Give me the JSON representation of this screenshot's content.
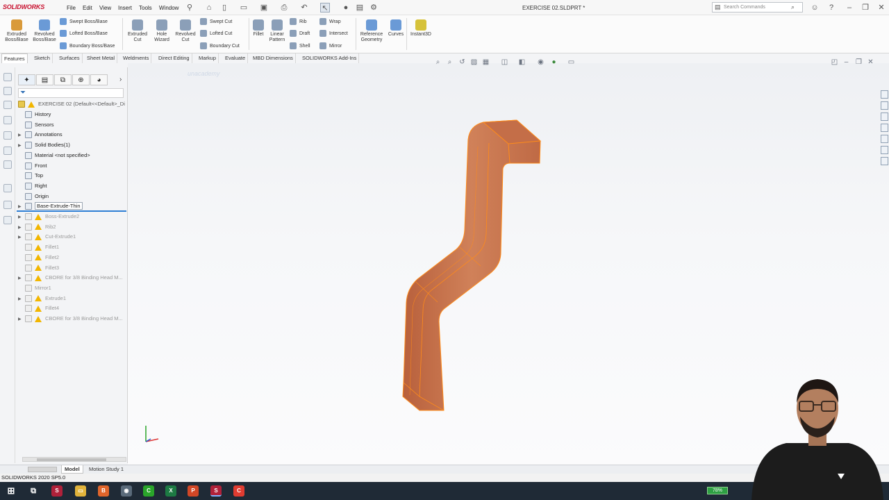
{
  "app": {
    "logo": "SOLIDWORKS",
    "document_title": "EXERCISE 02.SLDPRT *",
    "search_placeholder": "Search Commands",
    "status_text": "SOLIDWORKS 2020 SP5.0",
    "watermark": "unacademy"
  },
  "menu": [
    "File",
    "Edit",
    "View",
    "Insert",
    "Tools",
    "Window"
  ],
  "commands": {
    "extruded_boss": "Extruded\nBoss/Base",
    "revolved_boss": "Revolved\nBoss/Base",
    "swept_boss": "Swept Boss/Base",
    "lofted_boss": "Lofted Boss/Base",
    "boundary_boss": "Boundary Boss/Base",
    "extruded_cut": "Extruded\nCut",
    "hole_wizard": "Hole\nWizard",
    "revolved_cut": "Revolved\nCut",
    "swept_cut": "Swept Cut",
    "lofted_cut": "Lofted Cut",
    "boundary_cut": "Boundary Cut",
    "fillet": "Fillet",
    "linear_pattern": "Linear\nPattern",
    "rib": "Rib",
    "draft": "Draft",
    "shell": "Shell",
    "wrap": "Wrap",
    "intersect": "Intersect",
    "mirror": "Mirror",
    "reference_geometry": "Reference\nGeometry",
    "curves": "Curves",
    "instant3d": "Instant3D"
  },
  "tabs": [
    "Features",
    "Sketch",
    "Surfaces",
    "Sheet Metal",
    "Weldments",
    "Direct Editing",
    "Markup",
    "Evaluate",
    "MBD Dimensions",
    "SOLIDWORKS Add-Ins"
  ],
  "tree": {
    "root": "EXERCISE 02  (Default<<Default>_Di",
    "items": [
      {
        "label": "History",
        "dim": false
      },
      {
        "label": "Sensors",
        "dim": false
      },
      {
        "label": "Annotations",
        "dim": false
      },
      {
        "label": "Solid Bodies(1)",
        "dim": false
      },
      {
        "label": "Material <not specified>",
        "dim": false
      },
      {
        "label": "Front",
        "dim": false
      },
      {
        "label": "Top",
        "dim": false
      },
      {
        "label": "Right",
        "dim": false
      },
      {
        "label": "Origin",
        "dim": false
      },
      {
        "label": "Base-Extrude-Thin",
        "dim": false
      },
      {
        "label": "Boss-Extrude2",
        "dim": true
      },
      {
        "label": "Rib2",
        "dim": true
      },
      {
        "label": "Cut-Extrude1",
        "dim": true
      },
      {
        "label": "Fillet1",
        "dim": true
      },
      {
        "label": "Fillet2",
        "dim": true
      },
      {
        "label": "Fillet3",
        "dim": true
      },
      {
        "label": "CBORE for 3/8 Binding Head M...",
        "dim": true
      },
      {
        "label": "Mirror1",
        "dim": true
      },
      {
        "label": "Extrude1",
        "dim": true
      },
      {
        "label": "Fillet4",
        "dim": true
      },
      {
        "label": "CBORE for 3/8 Binding Head M...",
        "dim": true
      }
    ]
  },
  "bottom_tabs": [
    "Model",
    "Motion Study 1"
  ],
  "taskbar": {
    "battery": "78%"
  },
  "colors": {
    "part": "#c9744c",
    "edge": "#ff8c1a",
    "accent": "#c8102e",
    "taskbar": "#1f2a36"
  }
}
